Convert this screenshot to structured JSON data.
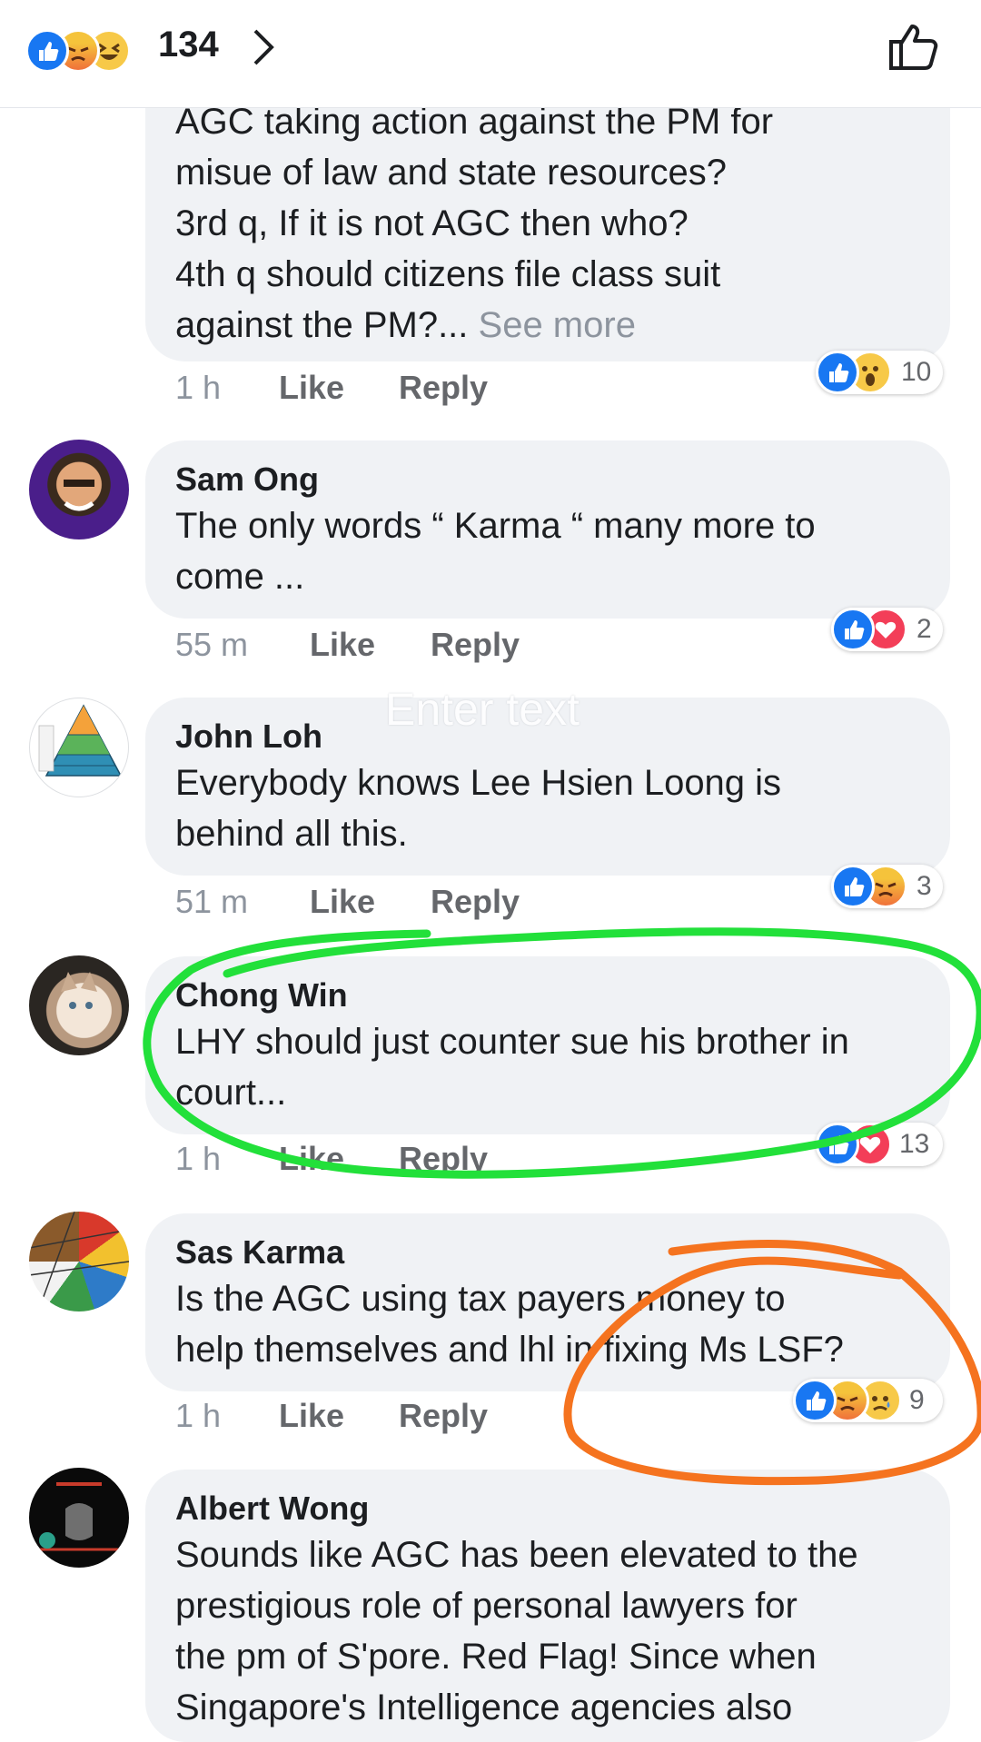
{
  "header": {
    "reaction_count": "134",
    "reaction_icons": [
      "like-icon",
      "angry-icon",
      "haha-icon"
    ],
    "chevron_icon": "chevron-right-icon",
    "like_button_icon": "thumbs-up-outline-icon"
  },
  "comments": [
    {
      "author": "",
      "text": "AGC taking action against the PM for\nmisue of law and state resources?\n3rd q, If it is not AGC then who?\n4th q should citizens file class suit\nagainst the PM?... ",
      "see_more": "See more",
      "time": "1 h",
      "like": "Like",
      "reply": "Reply",
      "reaction_count": "10",
      "reactions": [
        "like-icon",
        "wow-icon"
      ]
    },
    {
      "author": "Sam Ong",
      "text": "The only words “ Karma “ many more to\ncome ...",
      "time": "55 m",
      "like": "Like",
      "reply": "Reply",
      "reaction_count": "2",
      "reactions": [
        "like-icon",
        "love-icon"
      ]
    },
    {
      "author": "John Loh",
      "text": "Everybody knows Lee Hsien Loong is\nbehind all this.",
      "time": "51 m",
      "like": "Like",
      "reply": "Reply",
      "reaction_count": "3",
      "reactions": [
        "like-icon",
        "angry-icon"
      ]
    },
    {
      "author": "Chong Win",
      "text": "LHY should just counter sue his brother in\ncourt...",
      "time": "1 h",
      "like": "Like",
      "reply": "Reply",
      "reaction_count": "13",
      "reactions": [
        "like-icon",
        "love-icon"
      ]
    },
    {
      "author": "Sas Karma",
      "text": "Is the AGC using tax payers money to\nhelp themselves and lhl in fixing Ms LSF?",
      "time": "1 h",
      "like": "Like",
      "reply": "Reply",
      "reaction_count": "9",
      "reactions": [
        "like-icon",
        "angry-icon",
        "sad-icon"
      ]
    },
    {
      "author": "Albert Wong",
      "text": "Sounds like AGC has been elevated to the\nprestigious role of personal lawyers for\nthe pm of S'pore. Red Flag! Since when\nSingapore's Intelligence agencies also"
    }
  ],
  "overlay": {
    "placeholder": "Enter text"
  },
  "annotations": {
    "green_color": "#22e03a",
    "orange_color": "#f5731f"
  },
  "theme": {
    "bubble": "#f0f2f5",
    "like_blue": "#1877f2",
    "love_red": "#f33e58",
    "muted": "#65676b"
  }
}
